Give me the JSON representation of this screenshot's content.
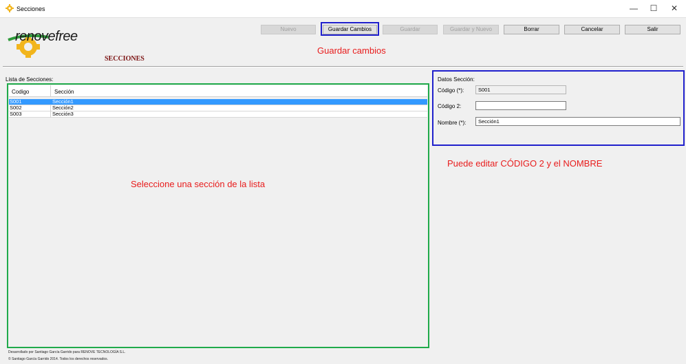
{
  "window": {
    "title": "Secciones",
    "minimize": "—",
    "maximize": "☐",
    "close": "✕"
  },
  "logo": {
    "text": "renovefree",
    "subtitle": "SECCIONES"
  },
  "toolbar": {
    "nuevo": "Nuevo",
    "guardar_cambios": "Guardar Cambios",
    "guardar": "Guardar",
    "guardar_nuevo": "Guardar y Nuevo",
    "borrar": "Borrar",
    "cancelar": "Cancelar",
    "salir": "Salir"
  },
  "annotations": {
    "guardar": "Guardar cambios",
    "editar": "Puede editar CÓDIGO 2 y el NOMBRE",
    "seleccione": "Seleccione una sección de la lista"
  },
  "list": {
    "label": "Lista de Secciones:",
    "columns": [
      "Codigo",
      "Sección"
    ],
    "rows": [
      {
        "codigo": "S001",
        "seccion": "Sección1",
        "selected": true
      },
      {
        "codigo": "S002",
        "seccion": "Sección2",
        "selected": false
      },
      {
        "codigo": "S003",
        "seccion": "Sección3",
        "selected": false
      }
    ]
  },
  "details": {
    "heading": "Datos Sección:",
    "codigo_label": "Código (*):",
    "codigo_value": "S001",
    "codigo2_label": "Código 2:",
    "codigo2_value": "",
    "nombre_label": "Nombre (*):",
    "nombre_value": "Sección1"
  },
  "footer": {
    "line1": "Desarrollado por Santiago García Garrido para RENOVE TECNOLOGÍA S.L.",
    "line2": "© Santiago García Garrido 2014. Todos los derechos reservados."
  },
  "colors": {
    "highlight_blue": "#1f1fcc",
    "highlight_green": "#1faa4a",
    "note_red": "#e81c1c",
    "selection": "#3399ff"
  }
}
